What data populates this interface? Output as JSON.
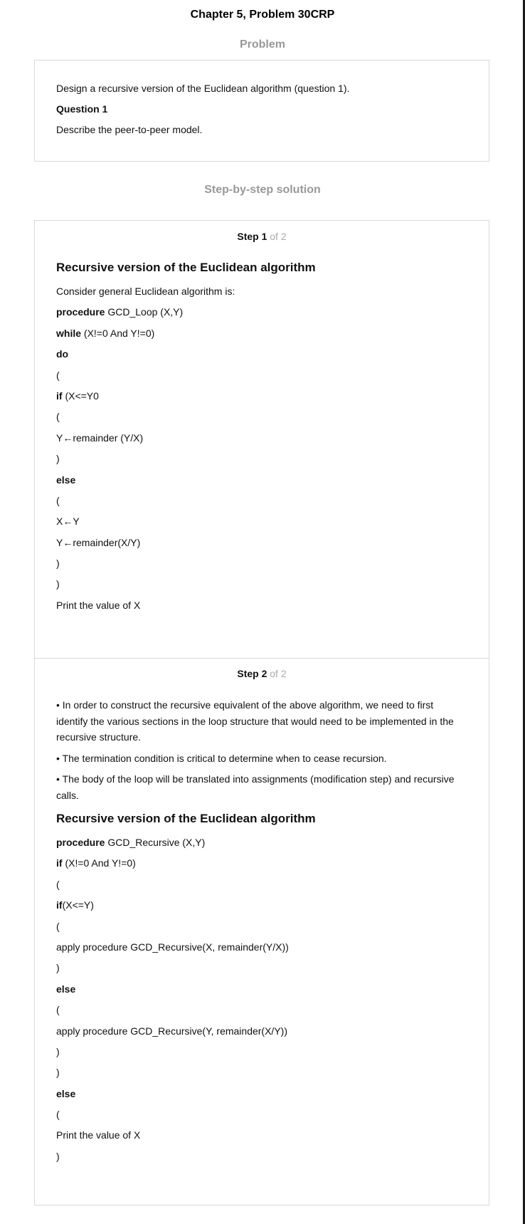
{
  "title": "Chapter 5, Problem 30CRP",
  "problem_heading": "Problem",
  "problem": {
    "statement": "Design a recursive version of the Euclidean algorithm (question 1).",
    "question_label": "Question 1",
    "question_text": "Describe the peer-to-peer model."
  },
  "solution_heading": "Step-by-step solution",
  "step1": {
    "label": "Step 1",
    "of": " of 2",
    "heading": "Recursive version of the Euclidean algorithm",
    "intro": "Consider general Euclidean algorithm is:",
    "code": [
      {
        "kw": "procedure",
        "text": " GCD_Loop (X,Y)"
      },
      {
        "kw": "while",
        "text": " (X!=0 And Y!=0)"
      },
      {
        "kw": "do",
        "text": ""
      },
      {
        "kw": "",
        "text": "("
      },
      {
        "kw": "if",
        "text": " (X<=Y0"
      },
      {
        "kw": "",
        "text": "("
      },
      {
        "kw": "",
        "text": "Y←remainder (Y/X)"
      },
      {
        "kw": "",
        "text": ")"
      },
      {
        "kw": "else",
        "text": ""
      },
      {
        "kw": "",
        "text": "("
      },
      {
        "kw": "",
        "text": "X←Y"
      },
      {
        "kw": "",
        "text": "Y←remainder(X/Y)"
      },
      {
        "kw": "",
        "text": ")"
      },
      {
        "kw": "",
        "text": ")"
      },
      {
        "kw": "",
        "text": "Print the value of X"
      }
    ]
  },
  "step2": {
    "label": "Step 2",
    "of": " of 2",
    "bullet1_l1": "• In order to construct the recursive equivalent of the above algorithm, we need to first",
    "bullet1_l2": "identify the various sections in the loop structure that would need to be implemented in the",
    "bullet1_l3": "recursive structure.",
    "bullet2": "• The termination condition is critical to determine when to cease recursion.",
    "bullet3_l1": "• The body of the loop will be translated into assignments (modification step) and recursive",
    "bullet3_l2": "calls.",
    "heading": "Recursive version of the Euclidean algorithm",
    "code": [
      {
        "kw": "procedure",
        "text": " GCD_Recursive (X,Y)"
      },
      {
        "kw": "if",
        "text": " (X!=0 And Y!=0)"
      },
      {
        "kw": "",
        "text": "("
      },
      {
        "kw": "if",
        "text": "(X<=Y)"
      },
      {
        "kw": "",
        "text": "("
      },
      {
        "kw": "",
        "text": "apply procedure GCD_Recursive(X, remainder(Y/X))"
      },
      {
        "kw": "",
        "text": ")"
      },
      {
        "kw": "else",
        "text": ""
      },
      {
        "kw": "",
        "text": "("
      },
      {
        "kw": "",
        "text": "apply procedure GCD_Recursive(Y, remainder(X/Y))"
      },
      {
        "kw": "",
        "text": ")"
      },
      {
        "kw": "",
        "text": ")"
      },
      {
        "kw": "else",
        "text": ""
      },
      {
        "kw": "",
        "text": "("
      },
      {
        "kw": "",
        "text": "Print the value of X"
      },
      {
        "kw": "",
        "text": ")"
      }
    ]
  }
}
